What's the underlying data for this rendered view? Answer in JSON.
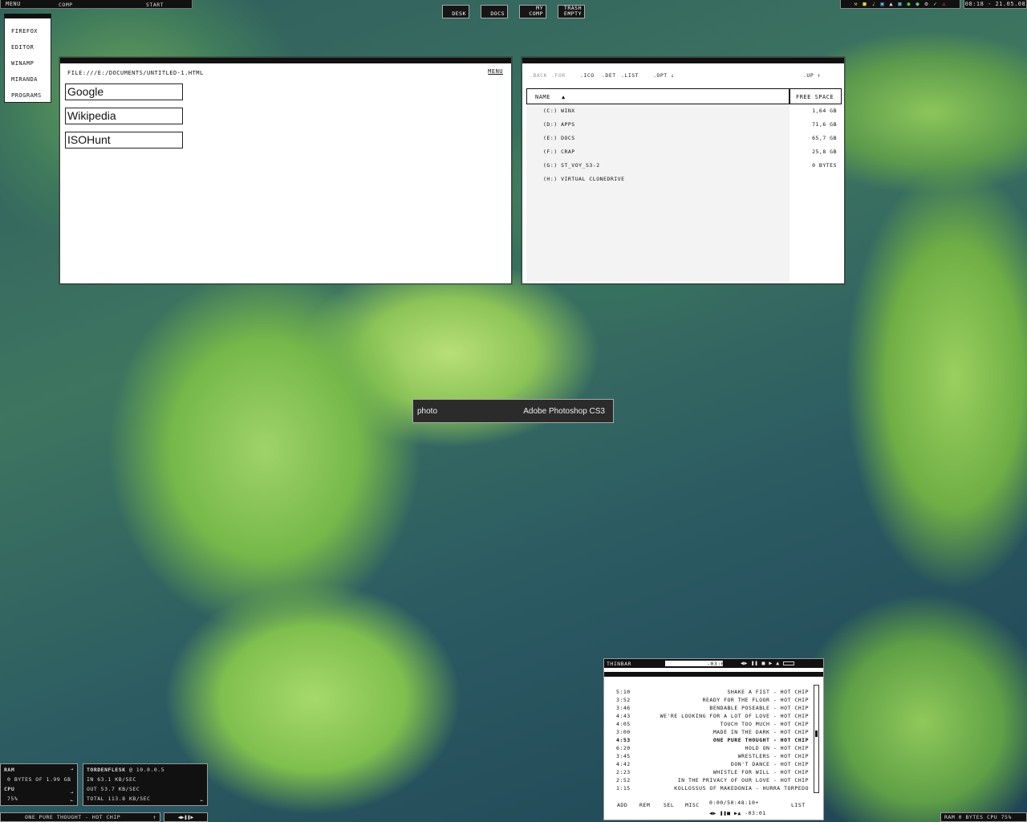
{
  "topbar": {
    "menu": "MENU",
    "comp": "COMP",
    "start": "START"
  },
  "startmenu": {
    "items": [
      "FIREFOX",
      "EDITOR",
      "WINAMP",
      "MIRANDA",
      "PROGRAMS"
    ]
  },
  "desktop_icons": [
    {
      "label": "DESK"
    },
    {
      "label": "DOCS"
    },
    {
      "label": "MY COMP"
    },
    {
      "label": "TRASH EMPTY"
    }
  ],
  "tray": {
    "icons": [
      "tool-icon",
      "folder-icon",
      "volume-icon",
      "network-icon",
      "chart-icon",
      "window-icon",
      "globe-icon",
      "bug-icon",
      "gear-icon",
      "check-icon",
      "warning-icon"
    ]
  },
  "clock": "08:18 - 21.05.08",
  "browser": {
    "address": "FILE:///E:/DOCUMENTS/UNTITLED-1.HTML",
    "menu": "MENU",
    "links": [
      "Google",
      "Wikipedia",
      "ISOHunt"
    ]
  },
  "explorer": {
    "toolbar": {
      "back": ".BACK",
      "for": ".FOR",
      "ico": ".ICO",
      "det": ".DET",
      "list": ".LIST",
      "opt": ".OPT",
      "up": ".UP"
    },
    "headers": {
      "name": "NAME",
      "free_space": "FREE SPACE"
    },
    "drives": [
      {
        "name": "(C:)  WINX",
        "free": "1,64 GB"
      },
      {
        "name": "(D:)  APPS",
        "free": "71,6 GB"
      },
      {
        "name": "(E:)  DOCS",
        "free": "65,7 GB"
      },
      {
        "name": "(F:)  CRAP",
        "free": "25,8 GB"
      },
      {
        "name": "(G:)  ST_VOY_S3-2",
        "free": "0 BYTES"
      },
      {
        "name": "(H:)  VIRTUAL CLONEDRIVE",
        "free": ""
      }
    ]
  },
  "launcher": {
    "query": "photo",
    "result": "Adobe Photoshop CS3"
  },
  "sysmon": {
    "ram_label": "RAM",
    "ram_value": "0 BYTES OF 1.99 GB",
    "cpu_label": "CPU",
    "cpu_value": "75%",
    "arrow": "→",
    "arrow_back": "←"
  },
  "torrent": {
    "title": "TORDENFLESK",
    "ip": "@ 10.0.0.5",
    "in": "IN    63.1 KB/SEC",
    "out": "OUT   53.7 KB/SEC",
    "total": "TOTAL   113.8 KB/SEC",
    "arrow_back": "←"
  },
  "player": {
    "title": "THINBAR",
    "time_remaining": "-03:01",
    "tracks": [
      {
        "time": "5:10",
        "name": "SHAKE A FIST - HOT CHIP"
      },
      {
        "time": "3:52",
        "name": "READY FOR THE FLOOR - HOT CHIP"
      },
      {
        "time": "3:46",
        "name": "BENDABLE POSEABLE - HOT CHIP"
      },
      {
        "time": "4:43",
        "name": "WE'RE LOOKING FOR A LOT OF LOVE - HOT CHIP"
      },
      {
        "time": "4:05",
        "name": "TOUCH TOO MUCH - HOT CHIP"
      },
      {
        "time": "3:00",
        "name": "MADE IN THE DARK - HOT CHIP"
      },
      {
        "time": "4:53",
        "name": "ONE PURE THOUGHT - HOT CHIP"
      },
      {
        "time": "6:20",
        "name": "HOLD ON - HOT CHIP"
      },
      {
        "time": "3:45",
        "name": "WRESTLERS - HOT CHIP"
      },
      {
        "time": "4:42",
        "name": "DON'T DANCE - HOT CHIP"
      },
      {
        "time": "2:23",
        "name": "WHISTLE FOR WILL - HOT CHIP"
      },
      {
        "time": "2:52",
        "name": "IN THE PRIVACY OF OUR LOVE - HOT CHIP"
      },
      {
        "time": "1:15",
        "name": "KOLLOSSUS OF MAKEDONIA - HURRA TORPEDO"
      }
    ],
    "current_index": 6,
    "buttons": {
      "add": "ADD",
      "rem": "REM",
      "sel": "SEL",
      "misc": "MISC",
      "list": "LIST"
    },
    "total_time": "0:00/50:48:10+",
    "time_remaining_bottom": "-03:01"
  },
  "nowplaying": {
    "text": "ONE PURE THOUGHT - HOT CHIP",
    "up": "↑"
  },
  "ramcpu": "RAM 0 BYTES   CPU 75%"
}
